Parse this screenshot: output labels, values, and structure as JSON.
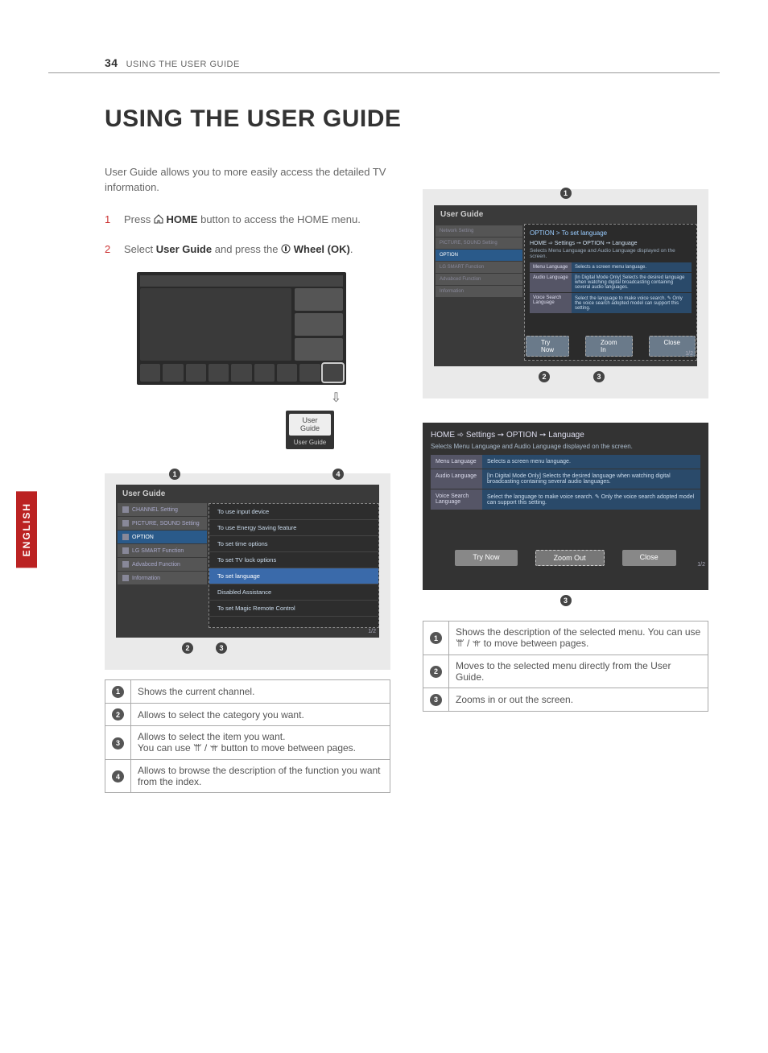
{
  "header": {
    "page_number": "34",
    "section": "USING THE USER GUIDE"
  },
  "title": "USING THE USER GUIDE",
  "side_tab": "ENGLISH",
  "intro": "User Guide allows you to more easily access the detailed TV information.",
  "steps": {
    "s1_num": "1",
    "s1_a": "Press ",
    "s1_home": "HOME",
    "s1_b": " button to access the HOME menu.",
    "s2_num": "2",
    "s2_a": "Select ",
    "s2_ug": "User Guide",
    "s2_b": " and press the ",
    "s2_wheel": "Wheel (OK)",
    "s2_c": "."
  },
  "ug_tile": {
    "line1": "User",
    "line2": "Guide",
    "caption": "User Guide"
  },
  "guide_panel": {
    "title": "User Guide",
    "categories": [
      "CHANNEL Setting",
      "PICTURE, SOUND Setting",
      "OPTION",
      "LG SMART Function",
      "Advabced Function",
      "Information"
    ],
    "items": [
      "To use input device",
      "To use Energy Saving feature",
      "To set time options",
      "To set TV lock options",
      "To set language",
      "Disabled Assistance",
      "To set Magic Remote Control"
    ],
    "page": "1/2"
  },
  "legend_left": {
    "r1": "Shows the current channel.",
    "r2": "Allows to select the category you want.",
    "r3": "Allows to select the item you want.\nYou can use ꕌ / ꕍ button to move between pages.",
    "r4": "Allows to browse the description of the function you want from the index."
  },
  "detail_panel": {
    "title": "User Guide",
    "breadcrumb": "OPTION > To set language",
    "path": "HOME ➾ Settings ➙ OPTION ➙ Language",
    "sub": "Selects Menu Language and Audio Language displayed on the screen.",
    "categories": [
      "Network Setting",
      "PICTURE, SOUND Setting",
      "OPTION",
      "LG SMART Function",
      "Advabced Function",
      "Information"
    ],
    "rows": [
      {
        "label": "Menu Language",
        "desc": "Selects a screen menu language."
      },
      {
        "label": "Audio Language",
        "desc": "[In Digital Mode Only] Selects the desired language when watching digital broadcasting containing several audio languages."
      },
      {
        "label": "Voice Search Language",
        "desc": "Select the language to make voice search. ✎ Only the voice search adopted model can support this setting."
      }
    ],
    "buttons": {
      "try": "Try Now",
      "zoom_in": "Zoom In",
      "close": "Close"
    },
    "page": "1/2"
  },
  "big_detail": {
    "path": "HOME ➾ Settings ➙ OPTION ➙ Language",
    "sub": "Selects Menu Language and Audio Language displayed on the screen.",
    "rows": [
      {
        "label": "Menu Language",
        "desc": "Selects a screen menu language."
      },
      {
        "label": "Audio Language",
        "desc": "[In Digital Mode Only] Selects the desired language when watching digital broadcasting containing several audio languages."
      },
      {
        "label": "Voice Search Language",
        "desc": "Select the language to make voice search. ✎ Only the voice search adopted model can support this setting."
      }
    ],
    "buttons": {
      "try": "Try Now",
      "zoom_out": "Zoom Out",
      "close": "Close"
    },
    "page": "1/2"
  },
  "legend_right": {
    "r1": "Shows the description of the selected menu. You can use ꕌ / ꕍ to move between pages.",
    "r2": "Moves to the selected menu directly from the User Guide.",
    "r3": "Zooms in or out the screen."
  },
  "callout_nums": {
    "c1": "1",
    "c2": "2",
    "c3": "3",
    "c4": "4"
  }
}
